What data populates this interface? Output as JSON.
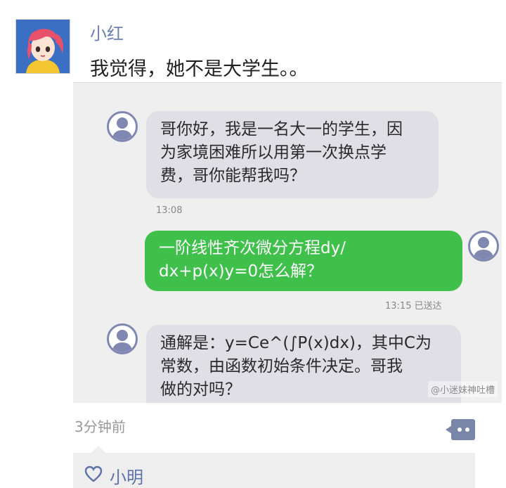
{
  "post": {
    "author": "小红",
    "text": "我觉得，她不是大学生。。",
    "time": "3分钟前"
  },
  "chat_screenshot": {
    "messages": [
      {
        "side": "incoming",
        "text": "哥你好，我是一名大一的学生，因为家境困难所以用第一次换点学费，哥你能帮我吗？",
        "lines": [
          "哥你好，我是一名大一的学生，因",
          "为家境困难所以用第一次换点学",
          "费，哥你能帮我吗？"
        ],
        "timestamp": "13:08"
      },
      {
        "side": "outgoing",
        "text": "一阶线性齐次微分方程dy/dx+p(x)y=0怎么解？",
        "lines": [
          "一阶线性齐次微分方程dy/",
          "dx+p(x)y=0怎么解？"
        ],
        "timestamp": "13:15 已送达"
      },
      {
        "side": "incoming",
        "text": "通解是：y=Ce^(∫P(x)dx)，其中C为常数，由函数初始条件决定。哥我做的对吗？",
        "lines": [
          "通解是：y=Ce^(∫P(x)dx)，其中C为",
          "常数，由函数初始条件决定。哥我",
          "做的对吗？"
        ],
        "timestamp": ""
      }
    ],
    "watermark": "@小迷妹神吐槽"
  },
  "likes": {
    "names": "小明"
  },
  "colors": {
    "name_blue": "#6a7fb3",
    "bubble_green": "#3fc04a",
    "bubble_gray": "#e0dfe5",
    "comment_icon": "#7a86a8"
  },
  "icons": {
    "comment": "comment-bubble-icon",
    "like": "heart-icon"
  }
}
